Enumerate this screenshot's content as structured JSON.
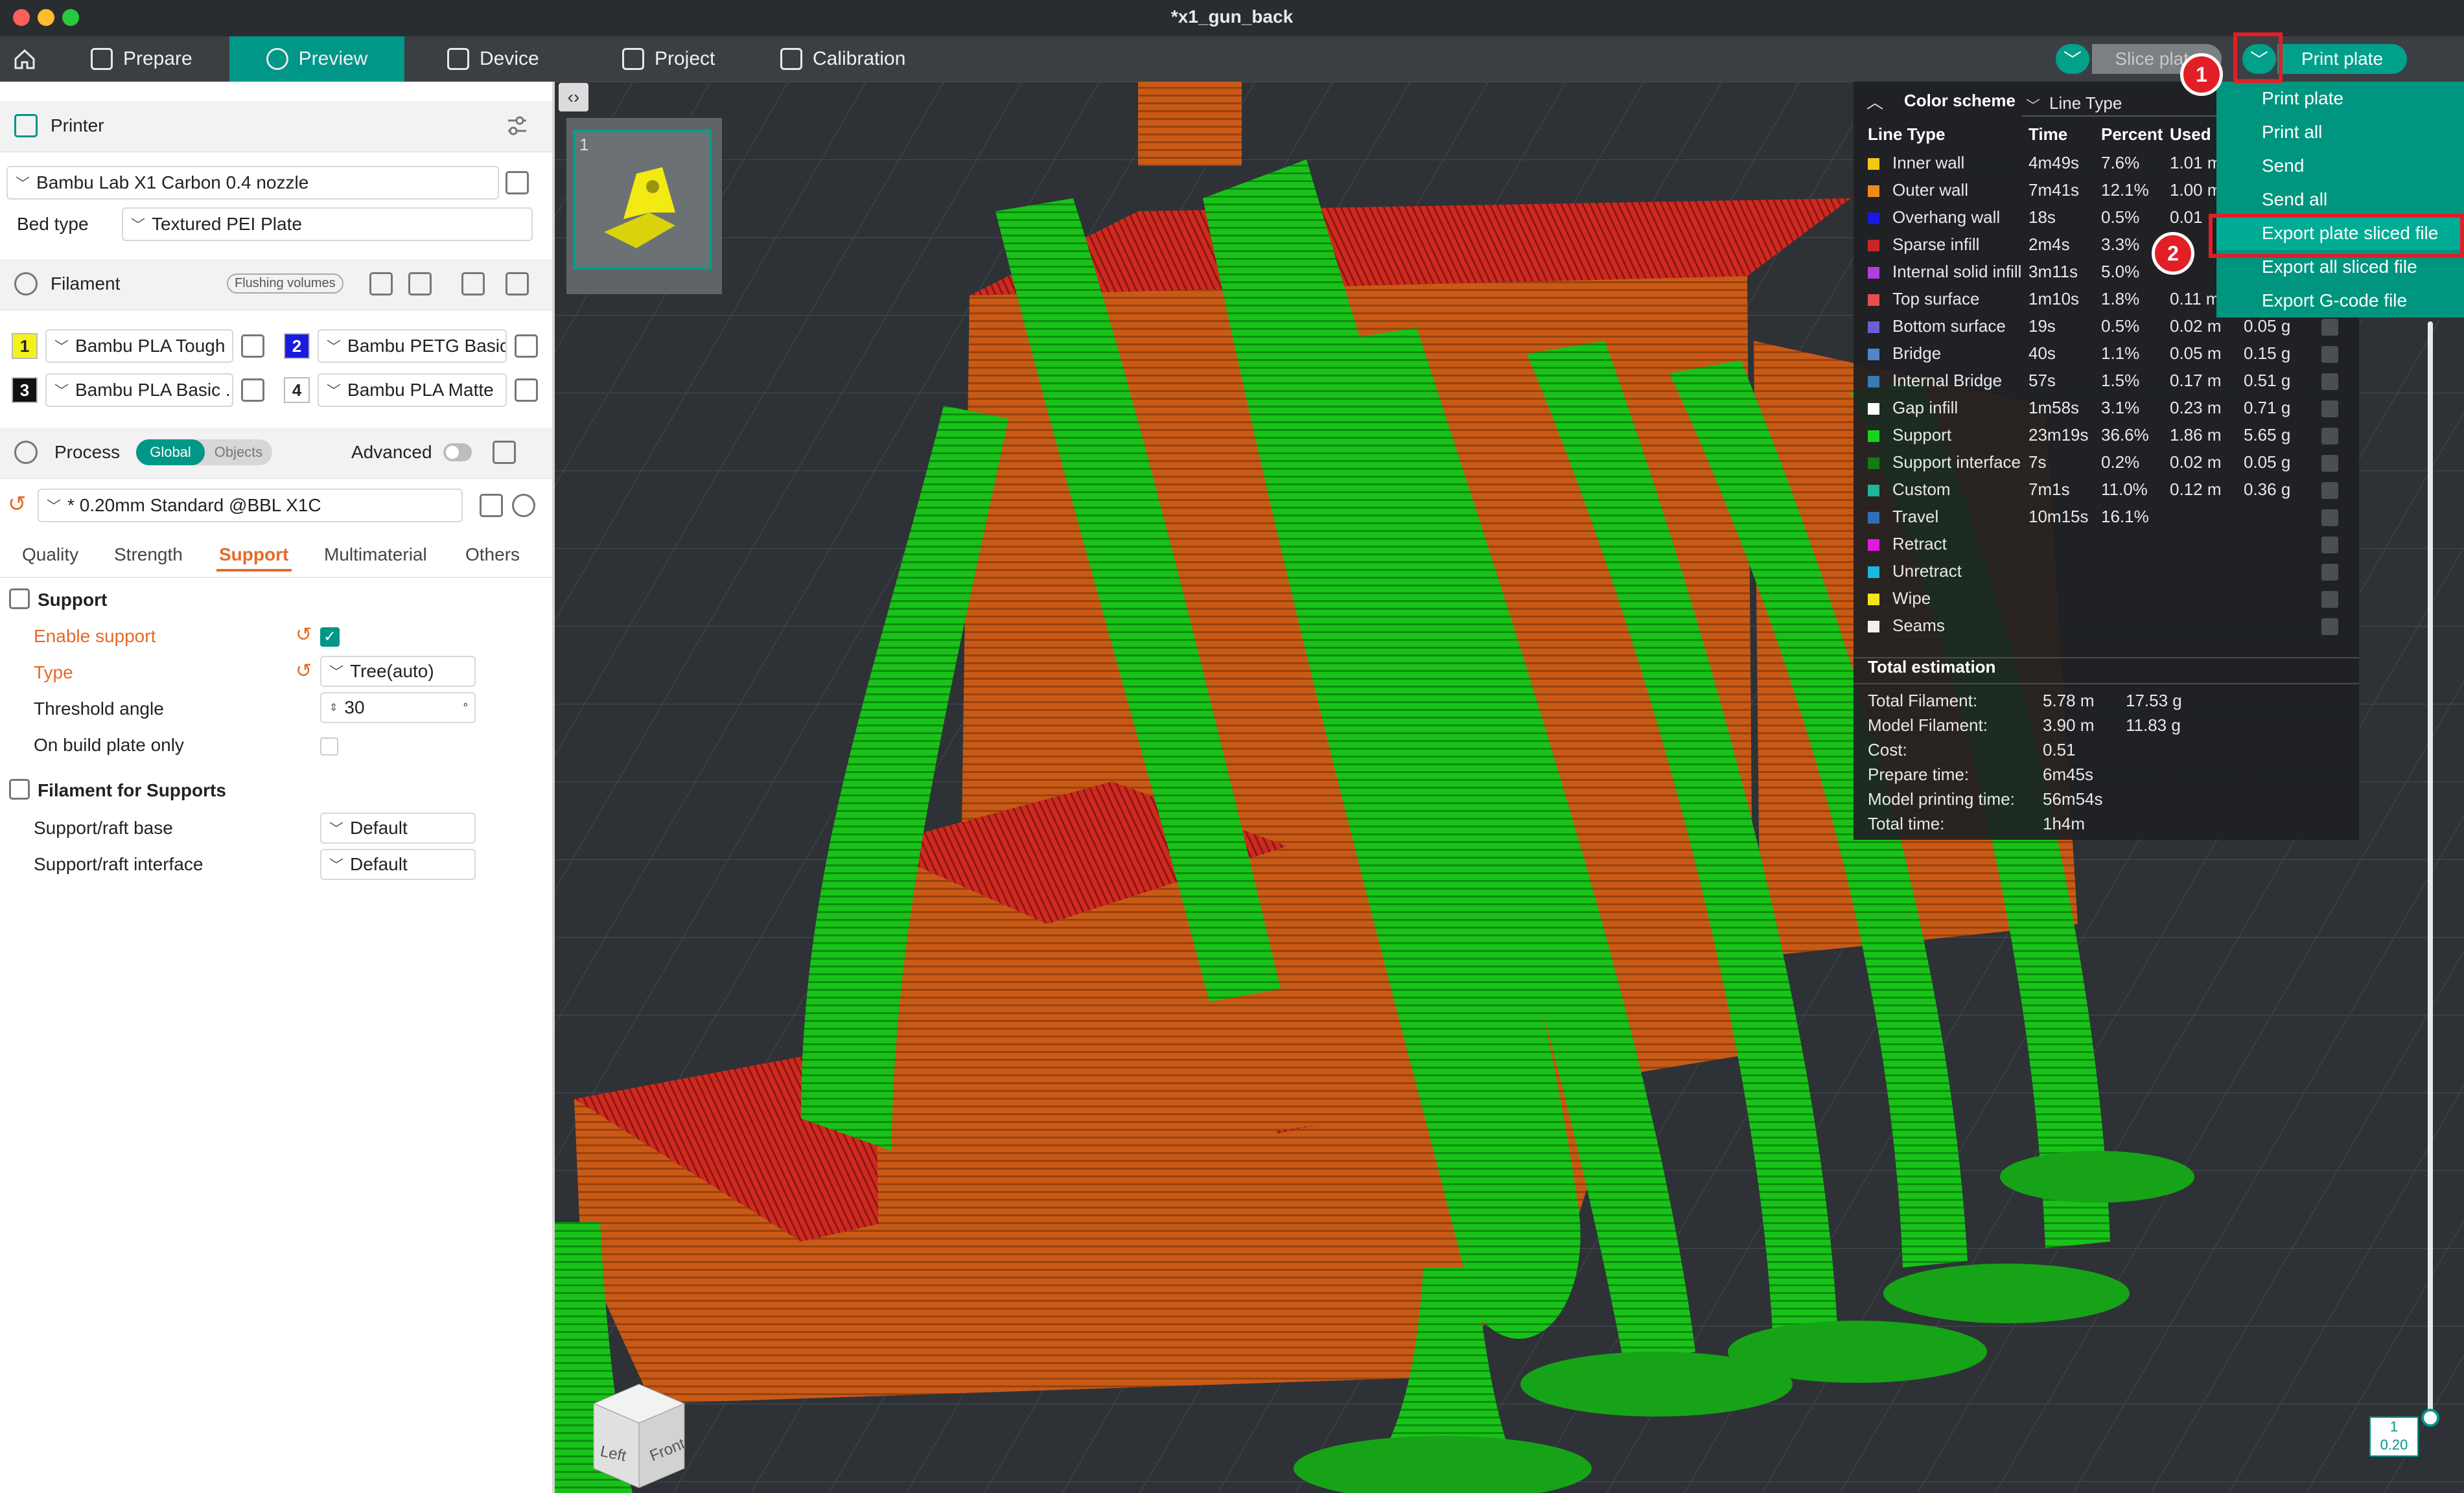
{
  "window": {
    "title": "*x1_gun_back"
  },
  "tabs": [
    {
      "label": "Prepare"
    },
    {
      "label": "Preview"
    },
    {
      "label": "Device"
    },
    {
      "label": "Project"
    },
    {
      "label": "Calibration"
    }
  ],
  "toolbar": {
    "slice_label": "Slice plate",
    "print_label": "Print plate"
  },
  "printer": {
    "section_label": "Printer",
    "name": "Bambu Lab X1 Carbon 0.4 nozzle",
    "bed_type_label": "Bed type",
    "bed_type": "Textured PEI Plate"
  },
  "filament": {
    "section_label": "Filament",
    "flushing_label": "Flushing volumes",
    "slots": [
      {
        "num": "1",
        "name": "Bambu PLA Tough",
        "color": "#f5f21b"
      },
      {
        "num": "2",
        "name": "Bambu PETG Basic",
        "color": "#1a1ae0"
      },
      {
        "num": "3",
        "name": "Bambu PLA Basic ...",
        "color": "#111111"
      },
      {
        "num": "4",
        "name": "Bambu PLA Matte",
        "color": "#ffffff"
      }
    ]
  },
  "process": {
    "section_label": "Process",
    "global_label": "Global",
    "objects_label": "Objects",
    "advanced_label": "Advanced",
    "preset": "* 0.20mm Standard @BBL X1C",
    "subtabs": [
      "Quality",
      "Strength",
      "Support",
      "Multimaterial",
      "Others"
    ],
    "active_subtab": "Support"
  },
  "support": {
    "group_label": "Support",
    "enable_label": "Enable support",
    "type_label": "Type",
    "type_value": "Tree(auto)",
    "threshold_label": "Threshold angle",
    "threshold_value": "30",
    "threshold_unit": "°",
    "build_plate_label": "On build plate only"
  },
  "filament_supports": {
    "group_label": "Filament for Supports",
    "base_label": "Support/raft base",
    "base_value": "Default",
    "interface_label": "Support/raft interface",
    "interface_value": "Default"
  },
  "plate_thumb": {
    "number": "1"
  },
  "legend": {
    "title": "Color scheme",
    "scheme": "Line Type",
    "headers": [
      "Line Type",
      "Time",
      "Percent",
      "Used"
    ],
    "rows": [
      {
        "name": "Inner wall",
        "color": "#f2c818",
        "time": "4m49s",
        "pct": "7.6%",
        "len": "1.01 m",
        "wt": ""
      },
      {
        "name": "Outer wall",
        "color": "#f08a18",
        "time": "7m41s",
        "pct": "12.1%",
        "len": "1.00 m",
        "wt": ""
      },
      {
        "name": "Overhang wall",
        "color": "#1a1ae0",
        "time": "18s",
        "pct": "0.5%",
        "len": "0.01",
        "wt": ""
      },
      {
        "name": "Sparse infill",
        "color": "#c8252a",
        "time": "2m4s",
        "pct": "3.3%",
        "len": "",
        "wt": ""
      },
      {
        "name": "Internal solid infill",
        "color": "#b33be0",
        "time": "3m11s",
        "pct": "5.0%",
        "len": "",
        "wt": ""
      },
      {
        "name": "Top surface",
        "color": "#e84e4e",
        "time": "1m10s",
        "pct": "1.8%",
        "len": "0.11 m",
        "wt": ""
      },
      {
        "name": "Bottom surface",
        "color": "#6b5fd6",
        "time": "19s",
        "pct": "0.5%",
        "len": "0.02 m",
        "wt": "0.05 g"
      },
      {
        "name": "Bridge",
        "color": "#4f86c9",
        "time": "40s",
        "pct": "1.1%",
        "len": "0.05 m",
        "wt": "0.15 g"
      },
      {
        "name": "Internal Bridge",
        "color": "#3a7ab8",
        "time": "57s",
        "pct": "1.5%",
        "len": "0.17 m",
        "wt": "0.51 g"
      },
      {
        "name": "Gap infill",
        "color": "#ffffff",
        "time": "1m58s",
        "pct": "3.1%",
        "len": "0.23 m",
        "wt": "0.71 g"
      },
      {
        "name": "Support",
        "color": "#18d418",
        "time": "23m19s",
        "pct": "36.6%",
        "len": "1.86 m",
        "wt": "5.65 g"
      },
      {
        "name": "Support interface",
        "color": "#127c12",
        "time": "7s",
        "pct": "0.2%",
        "len": "0.02 m",
        "wt": "0.05 g"
      },
      {
        "name": "Custom",
        "color": "#1ab79a",
        "time": "7m1s",
        "pct": "11.0%",
        "len": "0.12 m",
        "wt": "0.36 g"
      },
      {
        "name": "Travel",
        "color": "#2f6fb3",
        "time": "10m15s",
        "pct": "16.1%",
        "len": "",
        "wt": ""
      },
      {
        "name": "Retract",
        "color": "#e018e0",
        "time": "",
        "pct": "",
        "len": "",
        "wt": ""
      },
      {
        "name": "Unretract",
        "color": "#18b8e0",
        "time": "",
        "pct": "",
        "len": "",
        "wt": ""
      },
      {
        "name": "Wipe",
        "color": "#f5e51b",
        "time": "",
        "pct": "",
        "len": "",
        "wt": ""
      },
      {
        "name": "Seams",
        "color": "#f0f0f0",
        "time": "",
        "pct": "",
        "len": "",
        "wt": ""
      }
    ],
    "estimation": {
      "title": "Total estimation",
      "rows": [
        {
          "label": "Total Filament:",
          "v1": "5.78 m",
          "v2": "17.53 g"
        },
        {
          "label": "Model Filament:",
          "v1": "3.90 m",
          "v2": "11.83 g"
        },
        {
          "label": "Cost:",
          "v1": "0.51",
          "v2": ""
        },
        {
          "label": "Prepare time:",
          "v1": "6m45s",
          "v2": ""
        },
        {
          "label": "Model printing time:",
          "v1": "56m54s",
          "v2": ""
        },
        {
          "label": "Total time:",
          "v1": "1h4m",
          "v2": ""
        }
      ]
    }
  },
  "menu": {
    "items": [
      "Print plate",
      "Print all",
      "Send",
      "Send all",
      "Export plate sliced file",
      "Export all sliced file",
      "Export G-code file"
    ],
    "highlighted": "Export plate sliced file"
  },
  "markers": [
    "1",
    "2"
  ],
  "layer_slider": {
    "layer": "1",
    "height": "0.20"
  },
  "view_cube": {
    "left": "Left",
    "front": "Front"
  },
  "colors": {
    "accent": "#009688",
    "support_green": "#18d418",
    "model_orange": "#c85a16",
    "highlight_red": "#e21f26"
  }
}
